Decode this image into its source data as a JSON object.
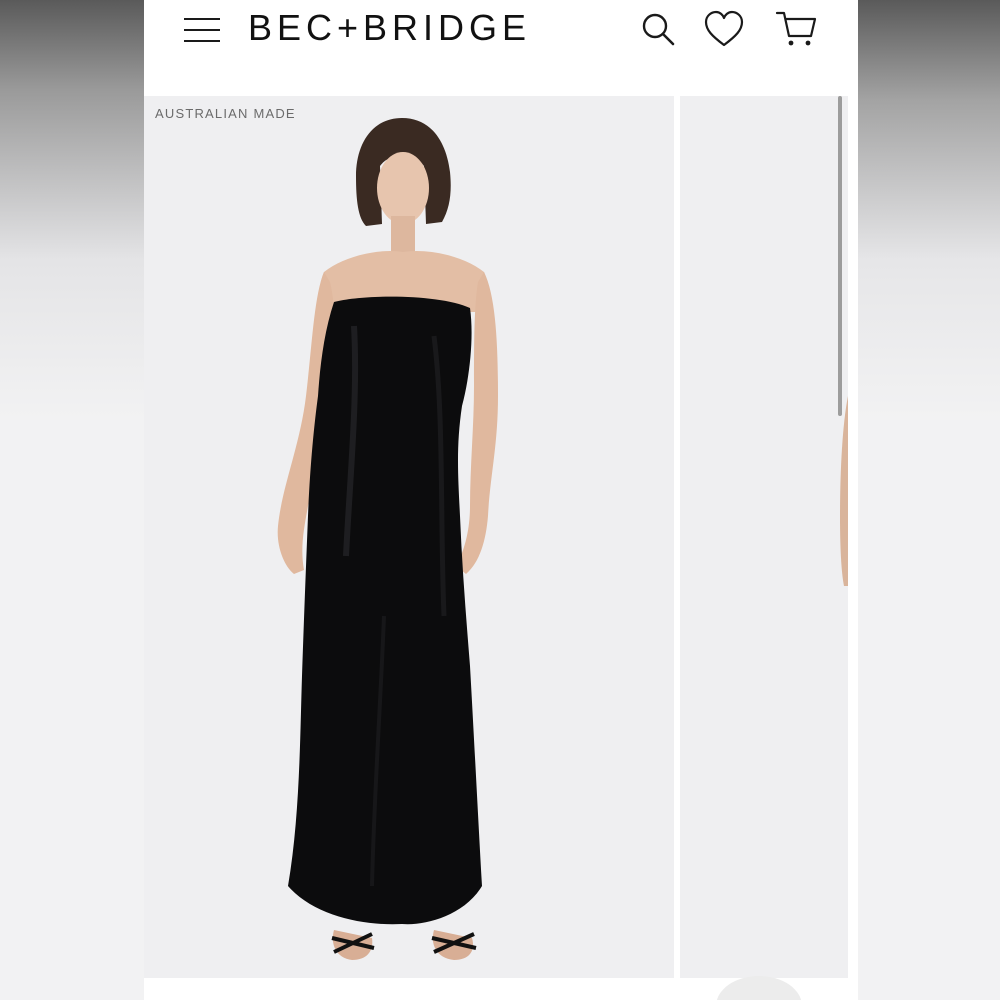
{
  "header": {
    "brand": "BEC+BRIDGE",
    "menu_icon": "hamburger-menu-icon",
    "search_icon": "search-icon",
    "wishlist_icon": "heart-icon",
    "cart_icon": "shopping-cart-icon"
  },
  "gallery": {
    "badge": "AUSTRALIAN MADE",
    "slides": [
      {
        "description_icon": "product-photo-black-strapless-maxi-dress"
      },
      {
        "description_icon": "product-photo-next"
      }
    ]
  },
  "colors": {
    "accent": "#111111",
    "photo_background": "#efeff1",
    "badge_text": "#6b6b6b"
  }
}
